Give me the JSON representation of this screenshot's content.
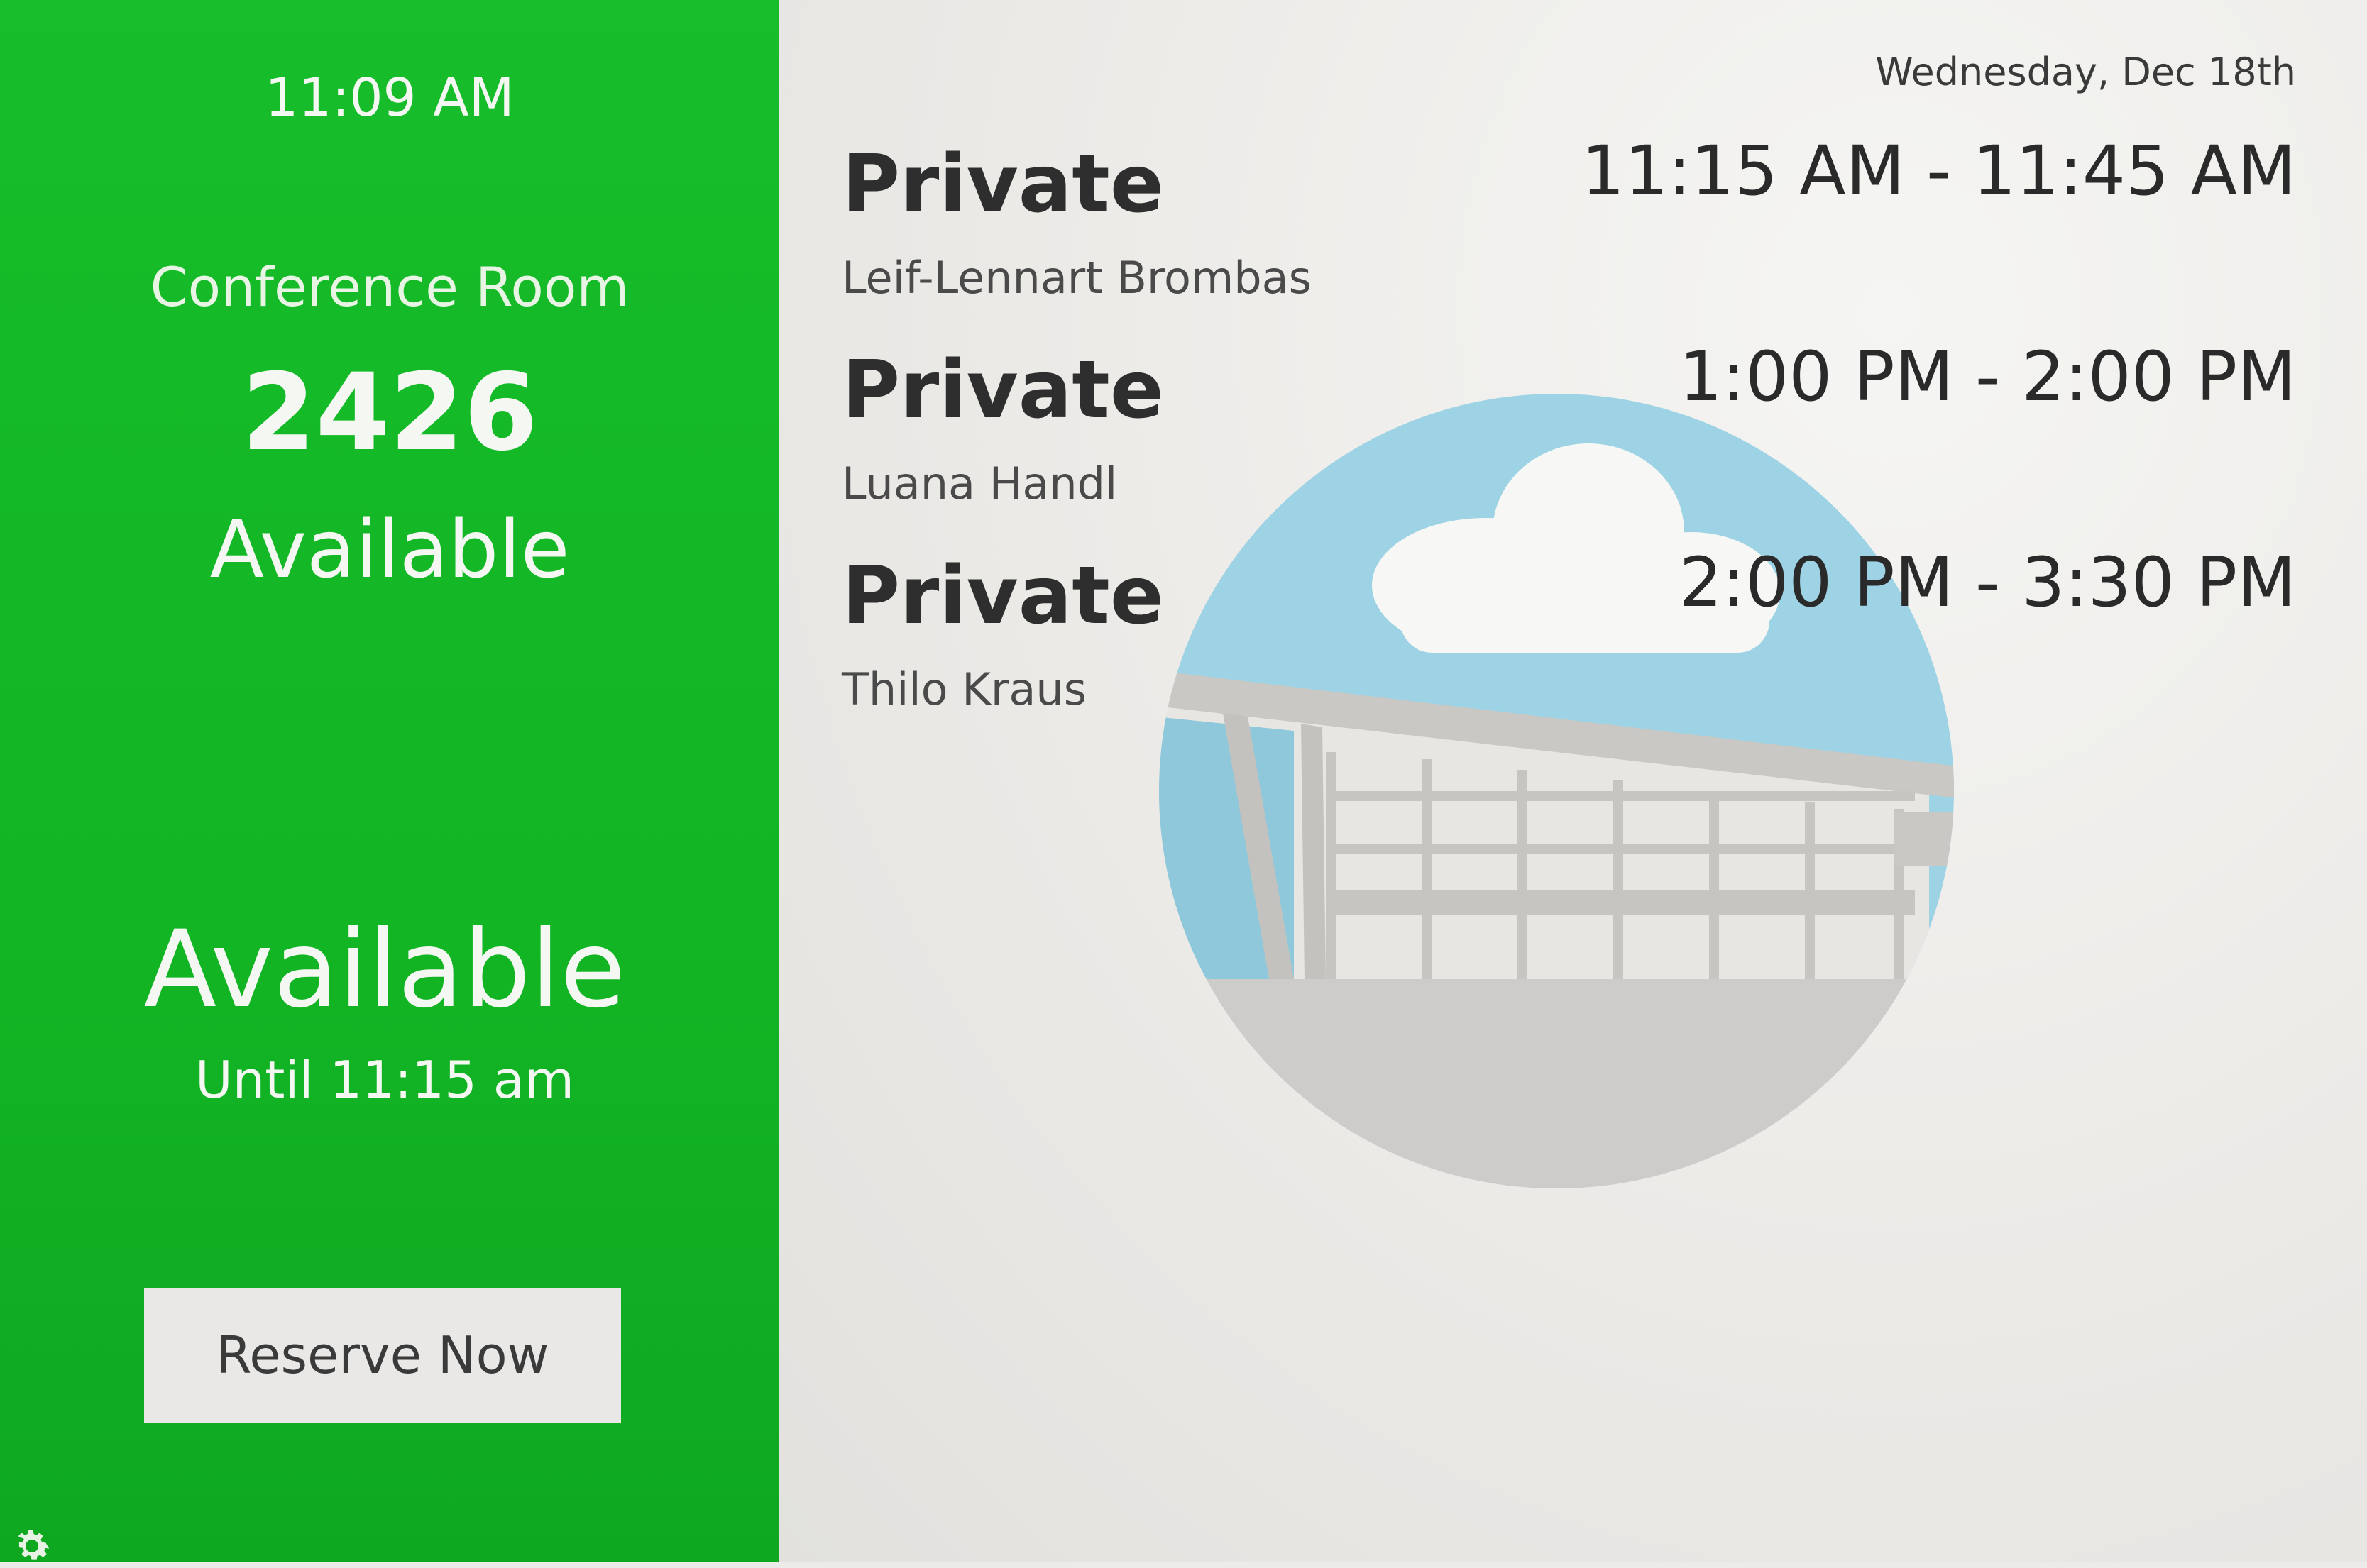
{
  "status_panel": {
    "clock": "11:09 AM",
    "room_label": "Conference Room",
    "room_number": "2426",
    "room_status": "Available",
    "big_status": "Available",
    "until": "Until 11:15 am",
    "reserve_label": "Reserve Now",
    "settings_icon": "gear-icon",
    "accent_color": "#14b526"
  },
  "schedule": {
    "date": "Wednesday, Dec 18th",
    "events": [
      {
        "title": "Private",
        "organizer": "Leif-Lennart Brombas",
        "time": "11:15 AM - 11:45 AM"
      },
      {
        "title": "Private",
        "organizer": "Luana Handl",
        "time": "1:00 PM - 2:00 PM"
      },
      {
        "title": "Private",
        "organizer": "Thilo Kraus",
        "time": "2:00 PM - 3:30 PM"
      }
    ]
  },
  "illustration": {
    "icon": "building-cloud-icon",
    "sky_color": "#9dd3e4",
    "building_color": "#cdccca"
  }
}
